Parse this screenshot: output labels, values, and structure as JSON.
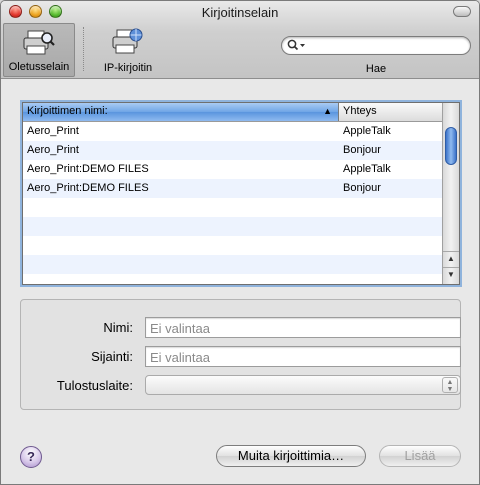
{
  "window": {
    "title": "Kirjoitinselain"
  },
  "toolbar": {
    "default_label": "Oletusselain",
    "ip_label": "IP-kirjoitin",
    "search_label": "Hae",
    "search_value": ""
  },
  "printers": {
    "columns": [
      "Kirjoittimen nimi:",
      "Yhteys"
    ],
    "rows": [
      {
        "name": "Aero_Print",
        "connection": "AppleTalk"
      },
      {
        "name": "Aero_Print",
        "connection": "Bonjour"
      },
      {
        "name": "Aero_Print:DEMO FILES",
        "connection": "AppleTalk"
      },
      {
        "name": "Aero_Print:DEMO FILES",
        "connection": "Bonjour"
      }
    ]
  },
  "details": {
    "name_label": "Nimi:",
    "name_value": "Ei valintaa",
    "location_label": "Sijainti:",
    "location_value": "Ei valintaa",
    "device_label": "Tulostuslaite:",
    "device_value": ""
  },
  "buttons": {
    "help": "?",
    "more_printers": "Muita kirjoittimia…",
    "add": "Lisää"
  },
  "colors": {
    "selection_header": "#6fa5e6",
    "stripe": "#edf3fe",
    "close": "#e0332a",
    "minimize": "#eba11d",
    "maximize": "#55b92d"
  }
}
